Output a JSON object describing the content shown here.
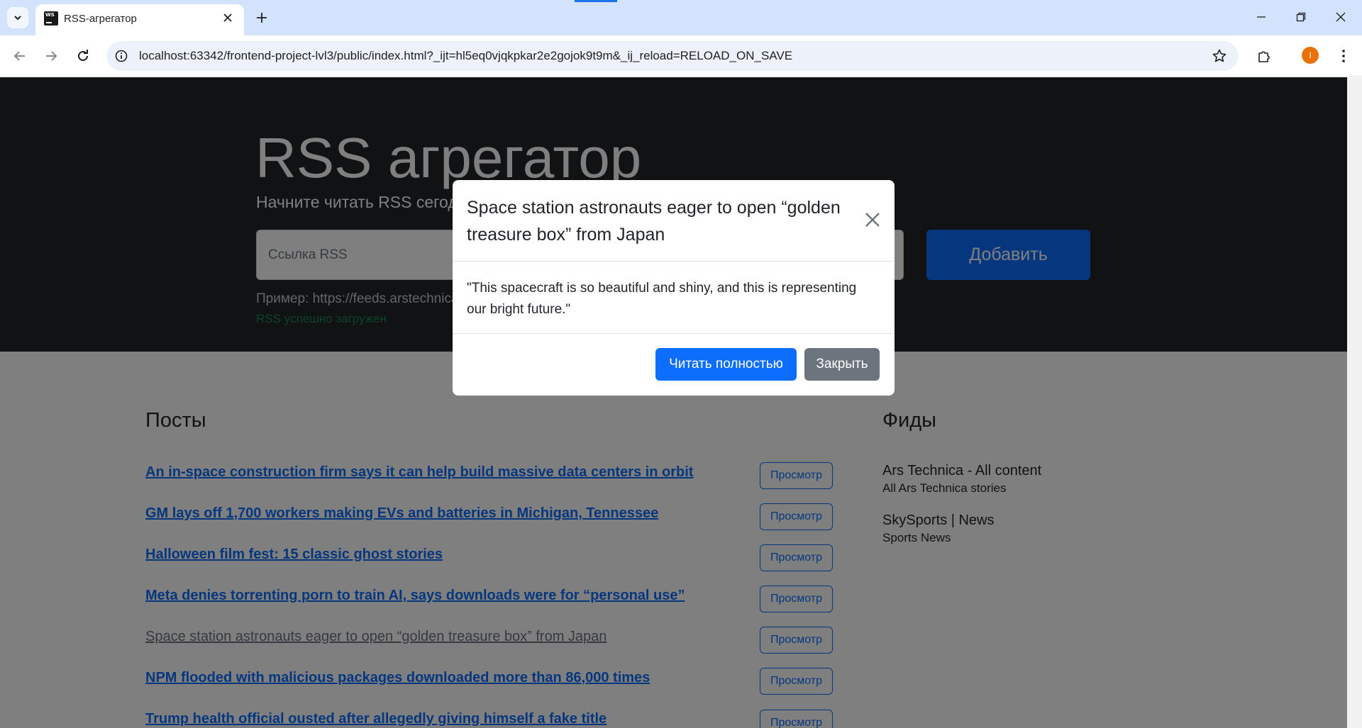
{
  "browser": {
    "tab_title": "RSS-агрегатор",
    "favicon_text": "WS",
    "url": "localhost:63342/frontend-project-lvl3/public/index.html?_ijt=hl5eq0vjqkpkar2e2gojok9t9m&_ij_reload=RELOAD_ON_SAVE",
    "profile_initial": "I",
    "icons": [
      "tab-search-icon",
      "close-icon",
      "plus-icon",
      "minimize-icon",
      "restore-icon",
      "back-icon",
      "forward-icon",
      "reload-icon",
      "info-icon",
      "star-icon",
      "extensions-icon",
      "kebab-menu-icon"
    ]
  },
  "hero": {
    "title": "RSS агрегатор",
    "lead": "Начните читать RSS сегодня! Это легко, это красиво.",
    "input_label": "Ссылка RSS",
    "add_button": "Добавить",
    "example": "Пример: https://feeds.arstechnica.com/arstechnica/index",
    "feedback": "RSS успешно загружен"
  },
  "posts": {
    "title": "Посты",
    "view_label": "Просмотр",
    "items": [
      {
        "title": "An in-space construction firm says it can help build massive data centers in orbit",
        "visited": false
      },
      {
        "title": "GM lays off 1,700 workers making EVs and batteries in Michigan, Tennessee",
        "visited": false
      },
      {
        "title": "Halloween film fest: 15 classic ghost stories",
        "visited": false
      },
      {
        "title": "Meta denies torrenting porn to train AI, says downloads were for “personal use”",
        "visited": false
      },
      {
        "title": "Space station astronauts eager to open “golden treasure box” from Japan",
        "visited": true
      },
      {
        "title": "NPM flooded with malicious packages downloaded more than 86,000 times",
        "visited": false
      },
      {
        "title": "Trump health official ousted after allegedly giving himself a fake title",
        "visited": false
      }
    ]
  },
  "feeds": {
    "title": "Фиды",
    "items": [
      {
        "title": "Ars Technica - All content",
        "description": "All Ars Technica stories"
      },
      {
        "title": "SkySports | News",
        "description": "Sports News"
      }
    ]
  },
  "modal": {
    "title": "Space station astronauts eager to open “golden treasure box” from Japan",
    "body": "\"This spacecraft is so beautiful and shiny, and this is representing our bright future.\"",
    "read_button": "Читать полностью",
    "close_button": "Закрыть"
  },
  "colors": {
    "primary": "#0d6efd",
    "secondary": "#6c757d",
    "success": "#198754",
    "dark": "#212529",
    "browser_accent": "#d3e3fd",
    "avatar": "#e8710a"
  }
}
